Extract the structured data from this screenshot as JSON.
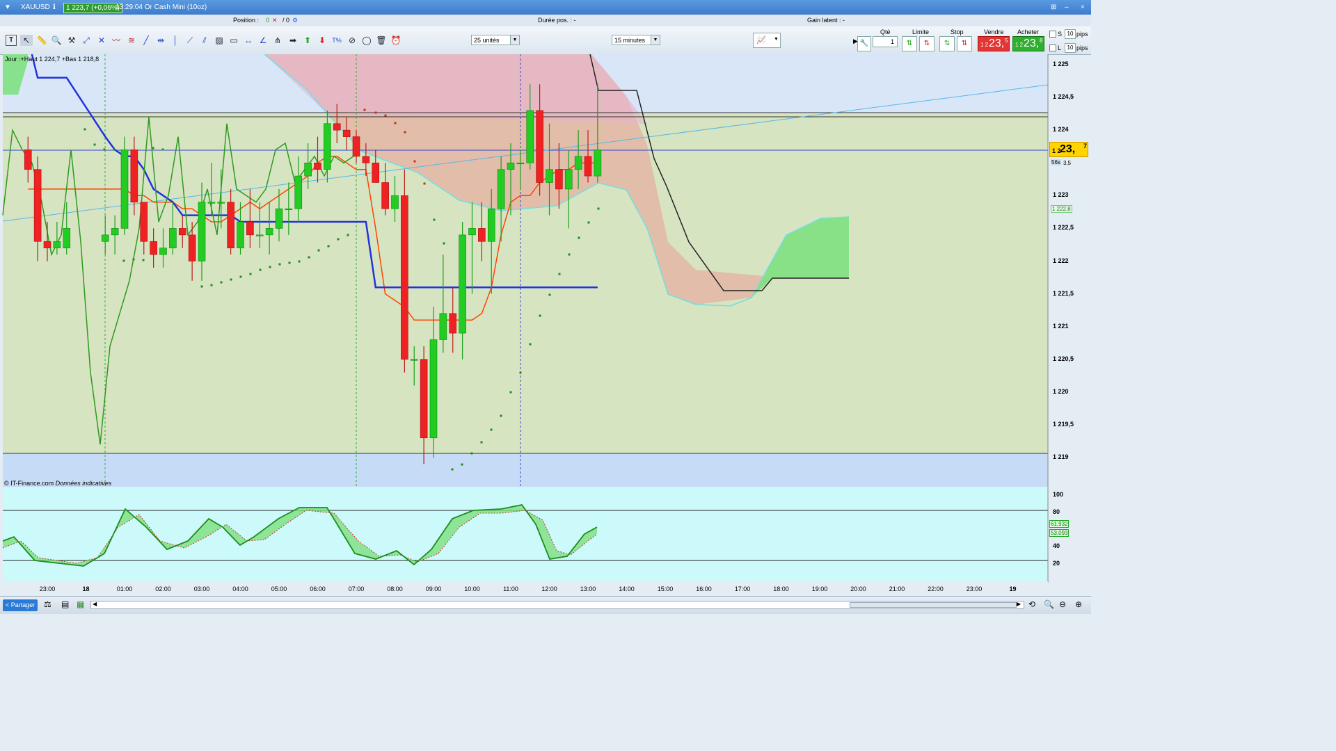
{
  "window": {
    "symbol": "XAUUSD",
    "price_change": "1 223,7 (+0,06%)",
    "time_title": "13:29:04 Or Cash Mini (10oz)",
    "win_controls": [
      "⊞",
      "–",
      "×"
    ]
  },
  "info": {
    "position_label": "Position :",
    "position_value": "0",
    "position_close": "✕",
    "position_value2": "/ 0",
    "duration_label": "Durée pos. : -",
    "latent_label": "Gain latent : -"
  },
  "toolbar": {
    "quantity_select": "25 unités",
    "interval_select": "15 minutes"
  },
  "trade": {
    "qty_label": "Qté",
    "qty_value": "1",
    "limit_label": "Limite",
    "stop_label": "Stop",
    "sell_label": "Vendre",
    "buy_label": "Acheter",
    "sell_small": "1 2",
    "sell_big": "23,",
    "sell_sup": "5",
    "buy_small": "1 2",
    "buy_big": "23,",
    "buy_sup": "8",
    "s_label": "S",
    "l_label": "L",
    "s_pips": "10",
    "l_pips": "10",
    "pips": "pips"
  },
  "chart": {
    "ichimoku_label": "Jour :+Haut 1 224,7 +Bas 1 218,8",
    "copyright": "© IT-Finance.com",
    "indicative": "Données indicatives",
    "price_current_small": "1 2",
    "price_current_big": "23,",
    "price_current_sup": "7",
    "countdown": "56s",
    "spread": "3,5",
    "cloud_value": "1 222,8",
    "y_ticks": [
      "1 225",
      "1 224,5",
      "1 224",
      "1 223",
      "1 222,5",
      "1 222",
      "1 221,5",
      "1 221",
      "1 220,5",
      "1 220",
      "1 219,5",
      "1 219"
    ],
    "x_ticks": [
      "23:00",
      "18",
      "01:00",
      "02:00",
      "03:00",
      "04:00",
      "05:00",
      "06:00",
      "07:00",
      "08:00",
      "09:00",
      "10:00",
      "11:00",
      "12:00",
      "13:00",
      "14:00",
      "15:00",
      "16:00",
      "17:00",
      "18:00",
      "19:00",
      "20:00",
      "21:00",
      "22:00",
      "23:00",
      "19"
    ],
    "osc_ticks": [
      "100",
      "80",
      "40",
      "20"
    ],
    "osc_k": "61,932",
    "osc_d": "53,093",
    "colors": {
      "up": "#22cc22",
      "down": "#ee2222",
      "kijun": "#2233dd",
      "tenkan": "#ff4400",
      "chikou": "#2e9a1e"
    }
  },
  "chart_data": {
    "type": "candlestick",
    "ylim": [
      1218.8,
      1225.2
    ],
    "x": [
      "22:30",
      "22:45",
      "23:00",
      "23:15",
      "23:30",
      "00:30",
      "00:45",
      "01:00",
      "01:15",
      "01:30",
      "01:45",
      "02:00",
      "02:15",
      "02:30",
      "02:45",
      "03:00",
      "03:15",
      "03:30",
      "03:45",
      "04:00",
      "04:15",
      "04:30",
      "04:45",
      "05:00",
      "05:15",
      "05:30",
      "05:45",
      "06:00",
      "06:15",
      "06:30",
      "06:45",
      "07:00",
      "07:15",
      "07:30",
      "07:45",
      "08:00",
      "08:15",
      "08:30",
      "08:45",
      "09:00",
      "09:15",
      "09:30",
      "09:45",
      "10:00",
      "10:15",
      "10:30",
      "10:45",
      "11:00",
      "11:15",
      "11:30",
      "11:45",
      "12:00",
      "12:15",
      "12:30",
      "12:45",
      "13:00",
      "13:15"
    ],
    "open": [
      1223.7,
      1223.4,
      1222.3,
      1222.2,
      1222.2,
      1222.3,
      1222.4,
      1222.5,
      1223.7,
      1222.9,
      1222.3,
      1222.1,
      1222.2,
      1222.5,
      1222.4,
      1222.0,
      1222.9,
      1222.9,
      1222.9,
      1222.2,
      1222.6,
      1222.4,
      1222.4,
      1222.5,
      1222.8,
      1222.8,
      1223.3,
      1223.5,
      1223.4,
      1224.1,
      1224.0,
      1223.9,
      1223.6,
      1223.5,
      1223.2,
      1222.8,
      1223.0,
      1220.5,
      1220.5,
      1219.3,
      1220.8,
      1221.2,
      1220.9,
      1222.4,
      1222.5,
      1222.3,
      1222.8,
      1223.4,
      1223.5,
      1223.5,
      1224.3,
      1223.2,
      1223.4,
      1223.1,
      1223.4,
      1223.6,
      1223.3
    ],
    "close": [
      1223.4,
      1222.3,
      1222.2,
      1222.3,
      1222.5,
      1222.4,
      1222.5,
      1223.7,
      1222.9,
      1222.3,
      1222.1,
      1222.2,
      1222.5,
      1222.4,
      1222.0,
      1222.9,
      1222.9,
      1222.9,
      1222.2,
      1222.6,
      1222.4,
      1222.4,
      1222.5,
      1222.8,
      1222.8,
      1223.3,
      1223.5,
      1223.4,
      1224.1,
      1224.0,
      1223.9,
      1223.6,
      1223.5,
      1223.2,
      1222.8,
      1223.0,
      1220.5,
      1220.5,
      1219.3,
      1220.8,
      1221.2,
      1220.9,
      1222.4,
      1222.5,
      1222.3,
      1222.8,
      1223.4,
      1223.5,
      1223.5,
      1224.3,
      1223.2,
      1223.4,
      1223.1,
      1223.4,
      1223.6,
      1223.3,
      1223.7
    ],
    "high": [
      1223.9,
      1223.6,
      1222.6,
      1222.6,
      1222.9,
      1222.7,
      1222.7,
      1223.9,
      1223.9,
      1222.9,
      1222.5,
      1222.5,
      1222.9,
      1222.7,
      1222.6,
      1223.2,
      1223.5,
      1223.4,
      1223.1,
      1222.9,
      1223.1,
      1222.9,
      1222.9,
      1223.1,
      1223.2,
      1223.6,
      1223.8,
      1223.9,
      1224.3,
      1224.4,
      1224.2,
      1224.0,
      1223.8,
      1223.7,
      1223.5,
      1223.3,
      1223.4,
      1220.7,
      1220.7,
      1221.3,
      1222.1,
      1221.6,
      1222.6,
      1222.9,
      1222.9,
      1223.1,
      1223.6,
      1223.8,
      1223.7,
      1224.7,
      1224.7,
      1224.1,
      1223.8,
      1223.7,
      1224.0,
      1224.0,
      1224.7
    ],
    "low": [
      1223.2,
      1222.0,
      1222.0,
      1222.1,
      1222.1,
      1222.1,
      1222.1,
      1222.4,
      1222.7,
      1222.1,
      1221.9,
      1221.9,
      1222.1,
      1222.2,
      1221.7,
      1221.7,
      1222.7,
      1222.5,
      1222.1,
      1222.1,
      1222.2,
      1222.2,
      1222.1,
      1222.3,
      1222.4,
      1222.6,
      1223.1,
      1223.2,
      1223.2,
      1223.8,
      1223.7,
      1223.5,
      1223.3,
      1223.2,
      1222.7,
      1222.6,
      1220.3,
      1220.1,
      1218.9,
      1219.0,
      1220.6,
      1220.6,
      1220.5,
      1221.5,
      1222.0,
      1221.5,
      1222.3,
      1222.7,
      1223.1,
      1223.4,
      1223.0,
      1222.7,
      1222.8,
      1222.5,
      1223.1,
      1223.2,
      1223.2
    ],
    "kijun": [
      1225.4,
      1224.8,
      1224.8,
      1224.8,
      1224.8,
      1223.9,
      1223.7,
      1223.6,
      1223.6,
      1223.4,
      1223.1,
      1223.0,
      1222.9,
      1222.7,
      1222.7,
      1222.7,
      1222.7,
      1222.7,
      1222.7,
      1222.6,
      1222.6,
      1222.6,
      1222.6,
      1222.6,
      1222.6,
      1222.6,
      1222.6,
      1222.6,
      1222.6,
      1222.6,
      1222.6,
      1222.6,
      1222.6,
      1221.6,
      1221.6,
      1221.6,
      1221.6,
      1221.6,
      1221.6,
      1221.6,
      1221.6,
      1221.6,
      1221.6,
      1221.6,
      1221.6,
      1221.6,
      1221.6,
      1221.6,
      1221.6,
      1221.6,
      1221.6,
      1221.6,
      1221.6,
      1221.6,
      1221.6,
      1221.6,
      1221.6
    ],
    "tenkan": [
      1223.1,
      1223.1,
      1223.1,
      1223.1,
      1223.1,
      1223.1,
      1223.1,
      1223.1,
      1223.0,
      1223.0,
      1222.9,
      1222.9,
      1222.9,
      1222.8,
      1222.8,
      1222.7,
      1222.6,
      1222.6,
      1222.7,
      1222.8,
      1222.9,
      1222.8,
      1222.9,
      1223.0,
      1223.1,
      1223.2,
      1223.3,
      1223.5,
      1223.6,
      1223.6,
      1223.5,
      1223.4,
      1223.4,
      1222.5,
      1221.5,
      1221.4,
      1221.3,
      1221.1,
      1221.1,
      1221.1,
      1221.1,
      1221.1,
      1221.1,
      1221.1,
      1221.2,
      1221.6,
      1222.4,
      1222.9,
      1223.0,
      1223.0,
      1223.2,
      1223.3,
      1223.4,
      1223.4,
      1223.5,
      1223.5,
      1223.5
    ],
    "chikou": [
      1222.7,
      1224.0,
      1223.7,
      1223.5,
      1222.9,
      1222.1,
      1222.4,
      1223.7,
      1222.3,
      1220.3,
      1219.2,
      1220.7,
      1221.2,
      1221.7,
      1222.5,
      1224.2,
      1222.6,
      1223.0,
      1223.9,
      1222.4,
      1222.6,
      1223.1,
      1222.4,
      1224.1,
      1223.1,
      1223.0,
      1222.9,
      1223.1,
      1223.7,
      1223.8,
      1223.2,
      1223.4,
      1223.6,
      1223.3,
      1223.6,
      1223.5,
      1223.6
    ]
  }
}
